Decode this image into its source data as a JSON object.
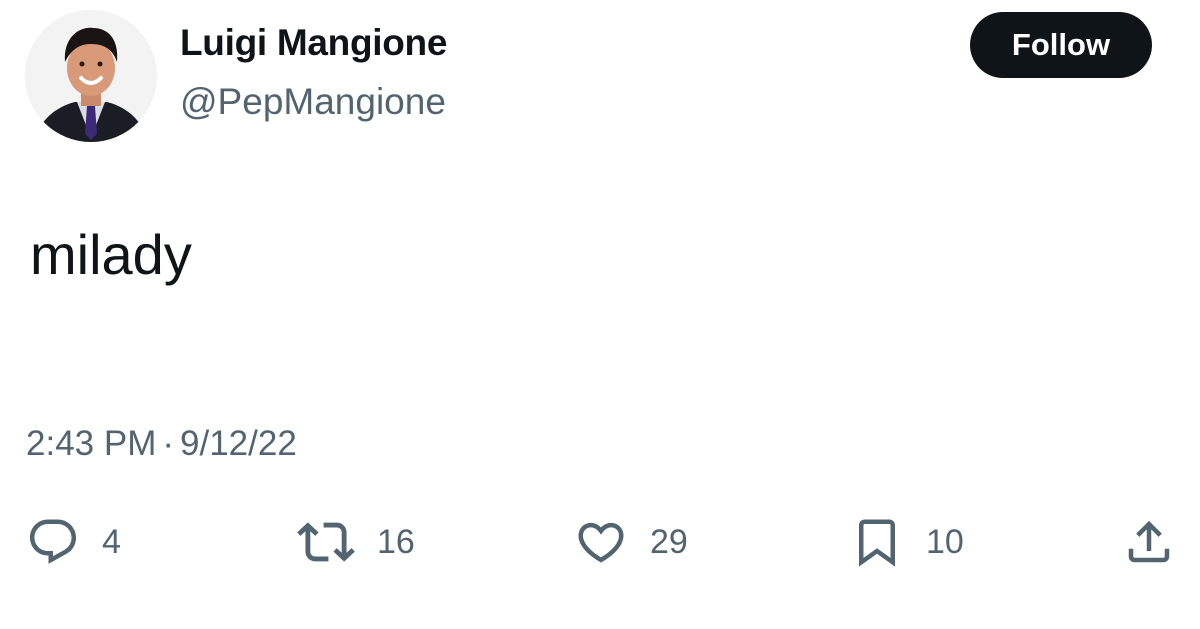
{
  "author": {
    "name": "Luigi Mangione",
    "handle": "@PepMangione"
  },
  "follow_button": {
    "label": "Follow"
  },
  "tweet": {
    "text": "milady",
    "time": "2:43 PM",
    "separator": "·",
    "date": "9/12/22"
  },
  "actions": {
    "reply": {
      "icon": "reply-icon",
      "count": "4"
    },
    "retweet": {
      "icon": "retweet-icon",
      "count": "16"
    },
    "like": {
      "icon": "heart-icon",
      "count": "29"
    },
    "bookmark": {
      "icon": "bookmark-icon",
      "count": "10"
    },
    "share": {
      "icon": "share-icon"
    }
  },
  "colors": {
    "text_primary": "#0f1419",
    "text_secondary": "#536471",
    "follow_bg": "#0f1419",
    "follow_text": "#ffffff"
  }
}
